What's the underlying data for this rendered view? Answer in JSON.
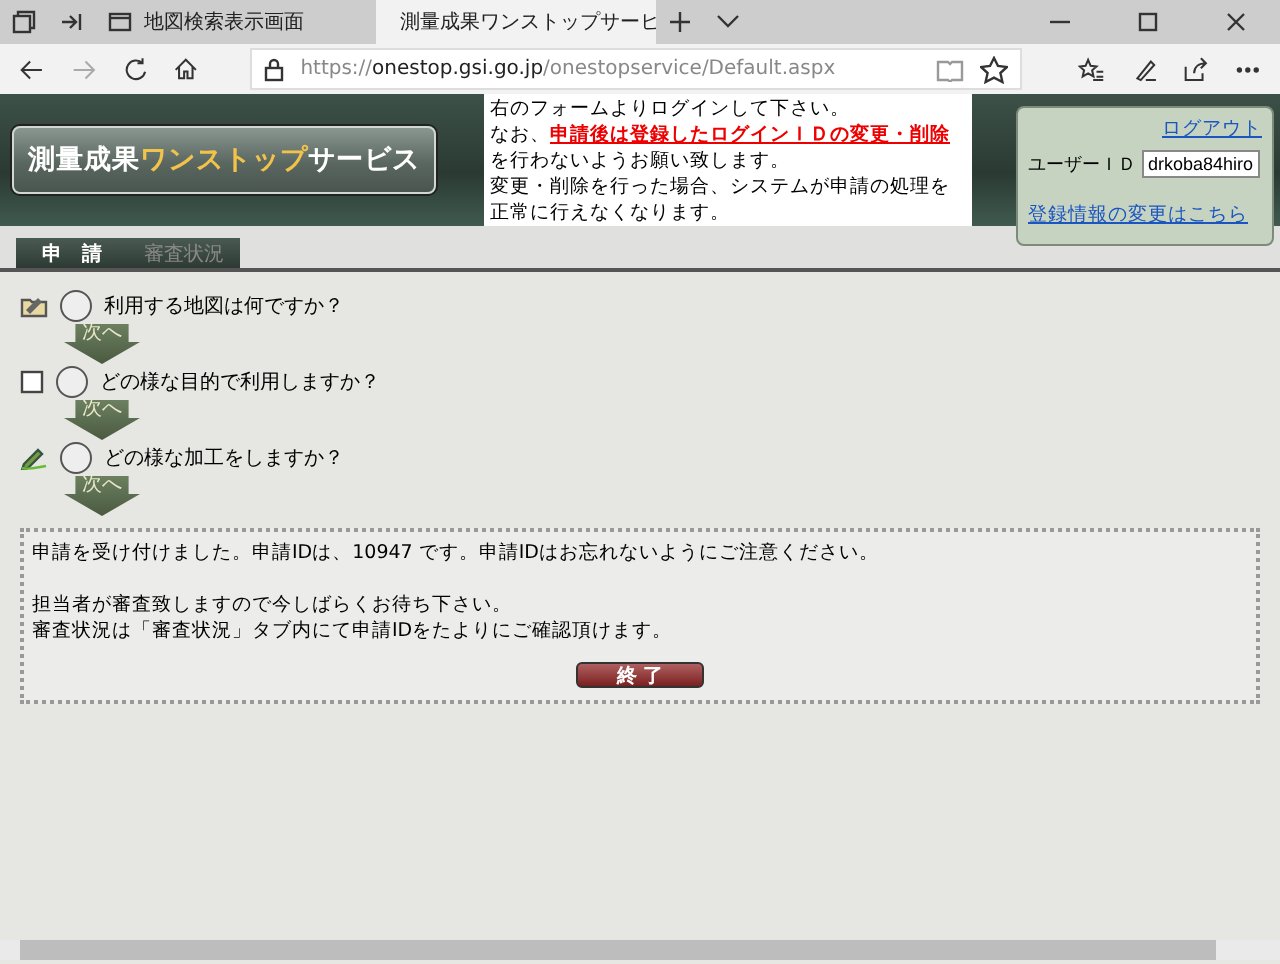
{
  "browser": {
    "tabs": [
      {
        "title": "地図検索表示画面",
        "selected": false
      },
      {
        "title": "測量成果ワンストップサーヒ",
        "selected": true
      }
    ],
    "address": "https://**onestop.gsi.go.jp**/onestopservice/Default.aspx"
  },
  "header": {
    "logo": {
      "lead": "測量成果",
      "highlight": "ワンストップ",
      "trail": "サービス"
    },
    "notice": [
      "右のフォームよりログインして下さい。",
      "なお、**申請後は登録したログインＩＤの変更・削除**を行わないようお願い致します。",
      "変更・削除を行った場合、システムが申請の処理を正常に行えなくなります。"
    ]
  },
  "login": {
    "logout_link": "ログアウト",
    "user_id_label": "ユーザーＩＤ",
    "user_id_value": "drkoba84hiro",
    "change_link": "登録情報の変更はこちら"
  },
  "page_tabs": [
    {
      "label": "申　請",
      "selected": true
    },
    {
      "label": "審査状況",
      "selected": false
    }
  ],
  "steps": [
    {
      "kind": "folder",
      "question": "利用する地図は何ですか？",
      "next": "次へ"
    },
    {
      "kind": "blank",
      "question": "どの様な目的で利用しますか？",
      "next": "次へ"
    },
    {
      "kind": "pencil",
      "question": "どの様な加工をしますか？",
      "next": "次へ"
    }
  ],
  "message": [
    [
      "申請を受け付けました。申請IDは、10947 です。申請IDはお忘れないようにご注意ください。"
    ],
    [
      "担当者が審査致しますので今しばらくお待ち下さい。",
      "審査状況は「審査状況」タブ内にて申請IDをたよりにご確認頂けます。"
    ]
  ],
  "finish_button": "終 了"
}
